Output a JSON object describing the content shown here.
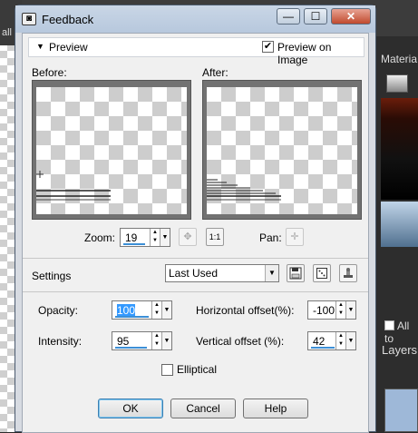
{
  "background": {
    "left_text": "all",
    "materials_label": "Materia",
    "all_tools_label": "All to",
    "layers_label": "Layers"
  },
  "window": {
    "title": "Feedback",
    "minimize": "—",
    "maximize": "☐",
    "close": "✕"
  },
  "preview": {
    "header_label": "Preview",
    "preview_on_image_label": "Preview on Image",
    "preview_on_image_checked": true,
    "before_label": "Before:",
    "after_label": "After:",
    "zoom_label": "Zoom:",
    "zoom_value": "19",
    "pan_label": "Pan:",
    "zoom_fit_icon": "✥",
    "zoom_one_to_one": "1:1"
  },
  "settings": {
    "label": "Settings",
    "preset": "Last Used"
  },
  "params": {
    "opacity_label": "Opacity:",
    "opacity_value": "100",
    "intensity_label": "Intensity:",
    "intensity_value": "95",
    "h_offset_label": "Horizontal offset(%):",
    "h_offset_value": "-100",
    "v_offset_label": "Vertical offset (%):",
    "v_offset_value": "42",
    "elliptical_label": "Elliptical",
    "elliptical_checked": false
  },
  "buttons": {
    "ok": "OK",
    "cancel": "Cancel",
    "help": "Help"
  }
}
